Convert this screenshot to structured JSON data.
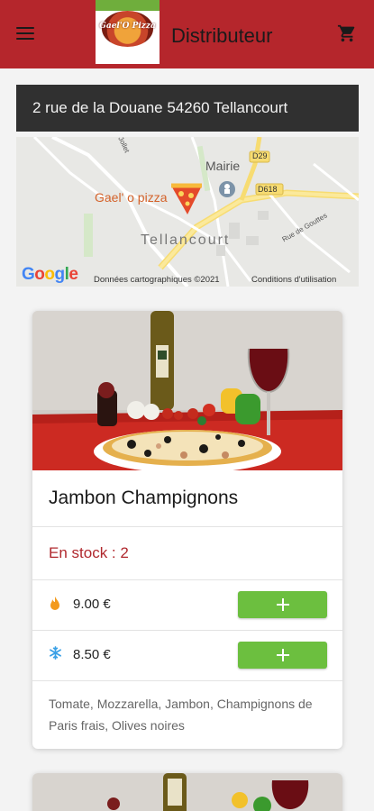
{
  "appbar": {
    "title": "Distributeur",
    "logo_text": "Gael'O Pizza",
    "menu_icon": "menu-icon",
    "cart_icon": "shopping-cart-icon",
    "color": "#b5262c"
  },
  "location": {
    "address": "2 rue de la Douane 54260 Tellancourt"
  },
  "map": {
    "marker_label": "Gael' o pizza",
    "labels": [
      "Mairie",
      "Tellancourt",
      "D29",
      "D618",
      "Rue de Gouttes",
      "Jollet"
    ],
    "google_logo": "Google",
    "credits": "Données cartographiques ©2021",
    "terms": "Conditions d'utilisation"
  },
  "products": [
    {
      "name": "Jambon Champignons",
      "stock": "En stock : 2",
      "prices": [
        {
          "type": "fire-icon",
          "value": "9.00 €"
        },
        {
          "type": "snowflake-icon",
          "value": "8.50 €"
        }
      ],
      "description": "Tomate, Mozzarella, Jambon, Champignons de Paris frais, Olives noires"
    }
  ],
  "colors": {
    "accent": "#b5262c",
    "add_button": "#6cbf3f",
    "stock_text": "#b0282e"
  }
}
